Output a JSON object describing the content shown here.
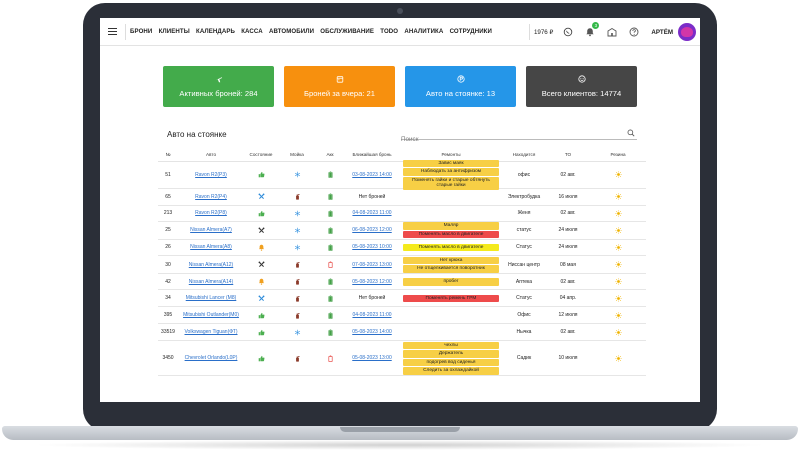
{
  "nav": {
    "items": [
      "БРОНИ",
      "КЛИЕНТЫ",
      "КАЛЕНДАРЬ",
      "КАССА",
      "АВТОМОБИЛИ",
      "ОБСЛУЖИВАНИЕ",
      "TODO",
      "АНАЛИТИКА",
      "СОТРУДНИКИ"
    ],
    "balance": "1976 ₽",
    "notification_count": "3",
    "user_name": "АРТЁМ"
  },
  "stats": [
    {
      "label": "Активных броней: 284",
      "color": "#43ab4b",
      "icon": "plane-icon"
    },
    {
      "label": "Броней за вчера: 21",
      "color": "#f7900e",
      "icon": "calendar-icon"
    },
    {
      "label": "Авто на стоянке: 13",
      "color": "#2596e8",
      "icon": "parking-icon"
    },
    {
      "label": "Всего клиентов: 14774",
      "color": "#464646",
      "icon": "smile-icon"
    }
  ],
  "section": {
    "title": "Авто на стоянке",
    "search_placeholder": "Поиск"
  },
  "table": {
    "headers": [
      "№",
      "Авто",
      "Состояние",
      "Мойка",
      "Акк",
      "Ближайшая бронь",
      "Ремонты",
      "Находится",
      "ТО",
      "Резина"
    ],
    "rows": [
      {
        "no": "51",
        "car": "Ravon R2(P3)",
        "state": "thumb",
        "wash": "snow",
        "battery": "green",
        "booking": "03-08-2023 14:00",
        "booking_link": true,
        "repairs": [
          {
            "text": "Завис маяк",
            "color": "yellow"
          },
          {
            "text": "Наблюдать за антифризом",
            "color": "yellow"
          },
          {
            "text": "Поменять гайки и старые обтянуть старые гайки",
            "color": "yellow"
          }
        ],
        "location": "офис",
        "to": "02 авг.",
        "tire": "sun"
      },
      {
        "no": "65",
        "car": "Ravon R2(P4)",
        "state": "tools-blue",
        "wash": "spray",
        "battery": "green",
        "booking": "Нет броней",
        "booking_link": false,
        "repairs": [],
        "location": "Электробудка",
        "to": "16 июля",
        "tire": "sun"
      },
      {
        "no": "213",
        "car": "Ravon R2(P8)",
        "state": "thumb",
        "wash": "snow",
        "battery": "green",
        "booking": "04-08-2023 11:00",
        "booking_link": true,
        "repairs": [],
        "location": "Женя",
        "to": "02 авг.",
        "tire": "sun"
      },
      {
        "no": "25",
        "car": "Nissan Almera(A7)",
        "state": "tools-dark",
        "wash": "snow",
        "battery": "green",
        "booking": "06-08-2023 12:00",
        "booking_link": true,
        "repairs": [
          {
            "text": "Маляр",
            "color": "yellow"
          },
          {
            "text": "Поменять масло в двигателе",
            "color": "red"
          }
        ],
        "location": "статус",
        "to": "24 июля",
        "tire": "sun"
      },
      {
        "no": "26",
        "car": "Nissan Almera(A8)",
        "state": "bell",
        "wash": "snow",
        "battery": "green",
        "booking": "05-08-2023 10:00",
        "booking_link": true,
        "repairs": [
          {
            "text": "Поменять масло в двигателе",
            "color": "bright"
          }
        ],
        "location": "Статус",
        "to": "24 июля",
        "tire": "sun"
      },
      {
        "no": "30",
        "car": "Nissan Almera(A12)",
        "state": "tools-dark",
        "wash": "spray",
        "battery": "red",
        "booking": "07-08-2023 13:00",
        "booking_link": true,
        "repairs": [
          {
            "text": "Нет крюка",
            "color": "yellow"
          },
          {
            "text": "Не отщелкивается поворотник",
            "color": "yellow"
          }
        ],
        "location": "Ниссан центр",
        "to": "08 мая",
        "tire": "sun"
      },
      {
        "no": "42",
        "car": "Nissan Almera(A14)",
        "state": "bell",
        "wash": "spray",
        "battery": "green",
        "booking": "05-08-2023 12:00",
        "booking_link": true,
        "repairs": [
          {
            "text": "пробег",
            "color": "yellow"
          }
        ],
        "location": "Аптека",
        "to": "02 авг.",
        "tire": "sun"
      },
      {
        "no": "34",
        "car": "Mitsubishi Lancer (M8)",
        "state": "tools-blue",
        "wash": "spray",
        "battery": "green",
        "booking": "Нет броней",
        "booking_link": false,
        "repairs": [
          {
            "text": "Поменять ремень ГРМ",
            "color": "red"
          }
        ],
        "location": "Статус",
        "to": "04 апр.",
        "tire": "sun"
      },
      {
        "no": "395",
        "car": "Mitsubishi Outlander(M0)",
        "state": "thumb",
        "wash": "spray",
        "battery": "green",
        "booking": "04-08-2023 11:00",
        "booking_link": true,
        "repairs": [],
        "location": "Офис",
        "to": "12 июля",
        "tire": "sun"
      },
      {
        "no": "33519",
        "car": "Volkswagen Tiguan(ФТ)",
        "state": "thumb",
        "wash": "snow",
        "battery": "green",
        "booking": "05-08-2023 14:00",
        "booking_link": true,
        "repairs": [],
        "location": "Нычка",
        "to": "02 авг.",
        "tire": "sun"
      },
      {
        "no": "3450",
        "car": "Chevrolet Orlando(L0P)",
        "state": "thumb",
        "wash": "spray",
        "battery": "red",
        "booking": "05-08-2023 13:00",
        "booking_link": true,
        "repairs": [
          {
            "text": "чехлы",
            "color": "yellow"
          },
          {
            "text": "Держатель",
            "color": "yellow"
          },
          {
            "text": "подогрев вод сиденья",
            "color": "yellow"
          },
          {
            "text": "Следить за охлаждайкой",
            "color": "yellow"
          }
        ],
        "location": "Садик",
        "to": "10 июля",
        "tire": "sun"
      }
    ]
  }
}
